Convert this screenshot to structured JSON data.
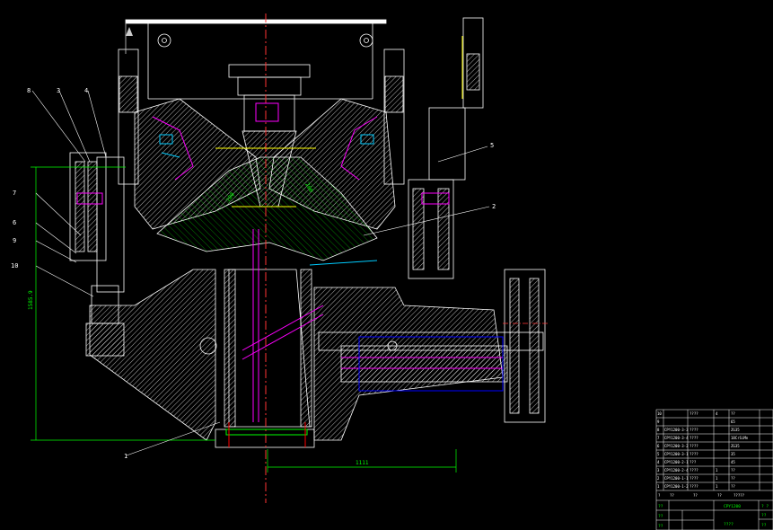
{
  "drawing": {
    "part_labels": {
      "p1": "1",
      "p2": "2",
      "p3": "3",
      "p4": "4",
      "p5": "5",
      "p6": "6",
      "p7": "7",
      "p8": "8",
      "p9": "9",
      "p10": "10"
    },
    "dims": {
      "vertical": "1585.9",
      "horizontal": "1111",
      "slope_left": "200",
      "slope_right": "200"
    }
  },
  "title_block": {
    "header": [
      "10",
      "????",
      "4",
      "??"
    ],
    "rows": [
      [
        "9",
        "????",
        "",
        "65"
      ],
      [
        "8",
        "CPY1200-3-3",
        "????",
        "ZG35"
      ],
      [
        "7",
        "CPY1200-3-4",
        "????",
        "18CrSiMn"
      ],
      [
        "6",
        "CPY1200-3-2",
        "????",
        "ZG35"
      ],
      [
        "5",
        "CPY1200-3-1",
        "????",
        "35"
      ],
      [
        "4",
        "CPY1200-2-1",
        "???",
        "45"
      ],
      [
        "3",
        "CPY1200-2-4",
        "????",
        "1",
        "??"
      ],
      [
        "2",
        "CPY1200-1-1",
        "????",
        "1",
        "??"
      ],
      [
        "1",
        "CPY1200-1-2",
        "????",
        "1",
        "??"
      ]
    ],
    "footer_headers": [
      "?",
      "??",
      "??",
      "??",
      "?????"
    ],
    "drawing_title": "CPY1200",
    "sub_title": "????",
    "small_codes": [
      "??",
      "??",
      "??"
    ],
    "right_codes": [
      "? ?",
      "??",
      "??"
    ]
  }
}
